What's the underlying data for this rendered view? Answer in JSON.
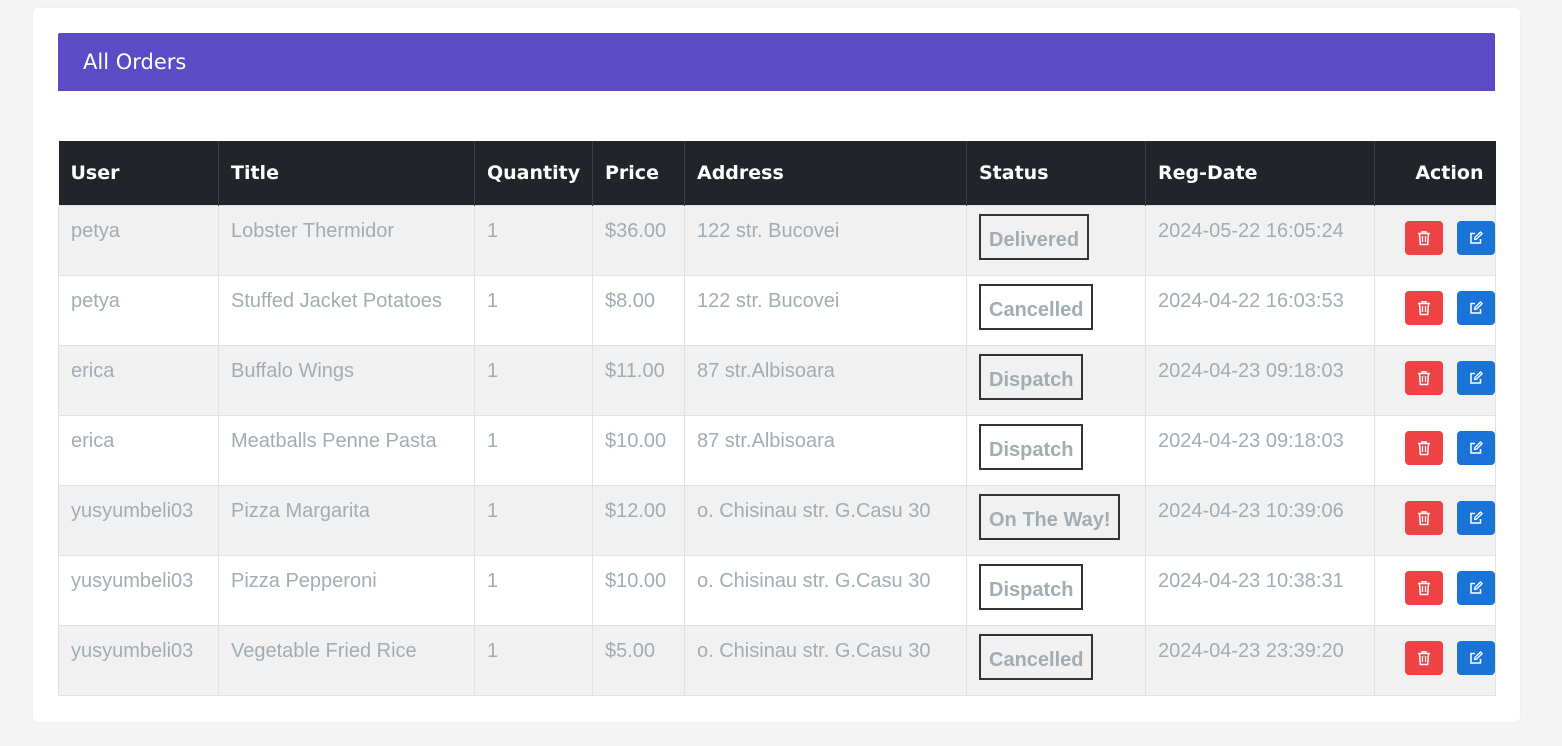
{
  "header": {
    "title": "All Orders",
    "bar_color": "#5b4bc6"
  },
  "table": {
    "columns": {
      "user": "User",
      "title": "Title",
      "quantity": "Quantity",
      "price": "Price",
      "address": "Address",
      "status": "Status",
      "reg_date": "Reg-Date",
      "action": "Action"
    },
    "rows": [
      {
        "user": "petya",
        "title": "Lobster Thermidor",
        "quantity": "1",
        "price": "$36.00",
        "address": "122 str. Bucovei",
        "status": "Delivered",
        "reg_date": "2024-05-22 16:05:24"
      },
      {
        "user": "petya",
        "title": "Stuffed Jacket Potatoes",
        "quantity": "1",
        "price": "$8.00",
        "address": "122 str. Bucovei",
        "status": "Cancelled",
        "reg_date": "2024-04-22 16:03:53"
      },
      {
        "user": "erica",
        "title": "Buffalo Wings",
        "quantity": "1",
        "price": "$11.00",
        "address": "87 str.Albisoara",
        "status": "Dispatch",
        "reg_date": "2024-04-23 09:18:03"
      },
      {
        "user": "erica",
        "title": "Meatballs Penne Pasta",
        "quantity": "1",
        "price": "$10.00",
        "address": "87 str.Albisoara",
        "status": "Dispatch",
        "reg_date": "2024-04-23 09:18:03"
      },
      {
        "user": "yusyumbeli03",
        "title": "Pizza Margarita",
        "quantity": "1",
        "price": "$12.00",
        "address": "o. Chisinau str. G.Casu 30",
        "status": "On The Way!",
        "reg_date": "2024-04-23 10:39:06"
      },
      {
        "user": "yusyumbeli03",
        "title": "Pizza Pepperoni",
        "quantity": "1",
        "price": "$10.00",
        "address": "o. Chisinau str. G.Casu 30",
        "status": "Dispatch",
        "reg_date": "2024-04-23 10:38:31"
      },
      {
        "user": "yusyumbeli03",
        "title": "Vegetable Fried Rice",
        "quantity": "1",
        "price": "$5.00",
        "address": "o. Chisinau str. G.Casu 30",
        "status": "Cancelled",
        "reg_date": "2024-04-23 23:39:20"
      }
    ]
  },
  "actions": {
    "delete_icon": "trash-icon",
    "edit_icon": "edit-icon",
    "delete_color": "#ee4245",
    "edit_color": "#1a74d8"
  }
}
